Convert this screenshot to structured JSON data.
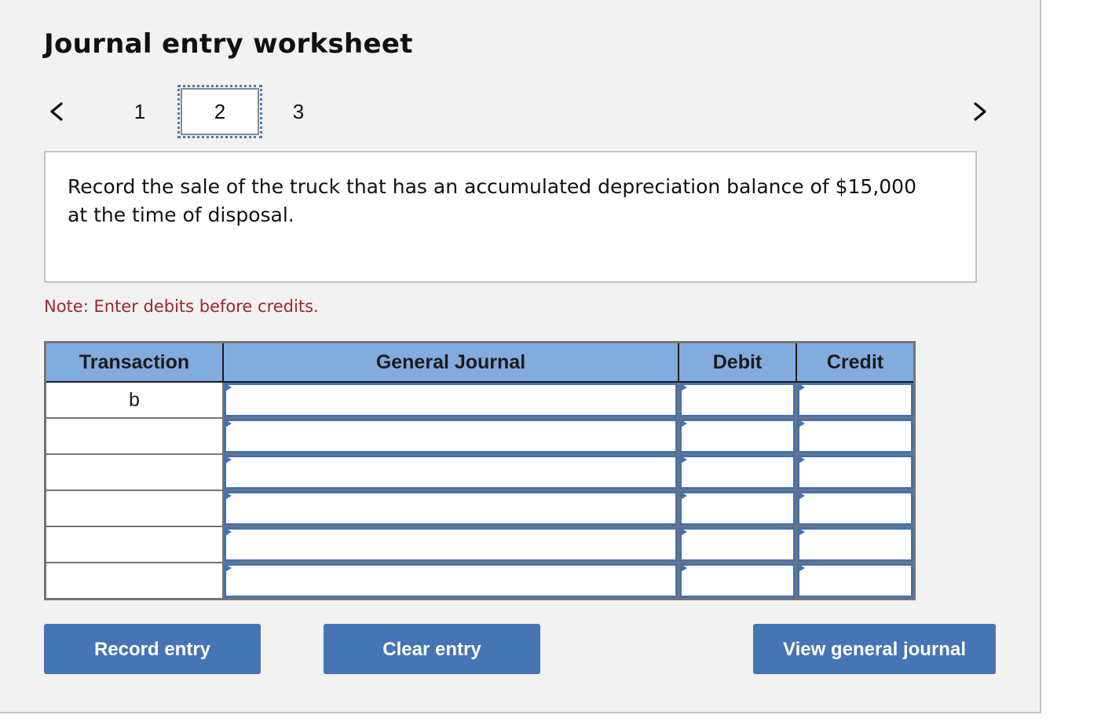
{
  "header": {
    "title": "Journal entry worksheet"
  },
  "navigation": {
    "prev_icon": "chevron-left-icon",
    "next_icon": "chevron-right-icon",
    "steps": [
      {
        "label": "1",
        "active": false
      },
      {
        "label": "2",
        "active": true
      },
      {
        "label": "3",
        "active": false
      }
    ]
  },
  "question": {
    "text": "Record the sale of the truck that has an accumulated depreciation balance of $15,000 at the time of disposal."
  },
  "note": "Note: Enter debits before credits.",
  "journal_table": {
    "headers": [
      "Transaction",
      "General Journal",
      "Debit",
      "Credit"
    ],
    "rows": [
      {
        "transaction": "b",
        "account": "",
        "debit": "",
        "credit": ""
      },
      {
        "transaction": "",
        "account": "",
        "debit": "",
        "credit": ""
      },
      {
        "transaction": "",
        "account": "",
        "debit": "",
        "credit": ""
      },
      {
        "transaction": "",
        "account": "",
        "debit": "",
        "credit": ""
      },
      {
        "transaction": "",
        "account": "",
        "debit": "",
        "credit": ""
      },
      {
        "transaction": "",
        "account": "",
        "debit": "",
        "credit": ""
      }
    ]
  },
  "buttons": {
    "record": "Record entry",
    "clear": "Clear entry",
    "view": "View general journal"
  },
  "colors": {
    "header_bg": "#82abdf",
    "button_bg": "#4675b4",
    "input_border": "#4472b0",
    "note_text": "#a3262a",
    "panel_bg": "#f2f2f2"
  }
}
